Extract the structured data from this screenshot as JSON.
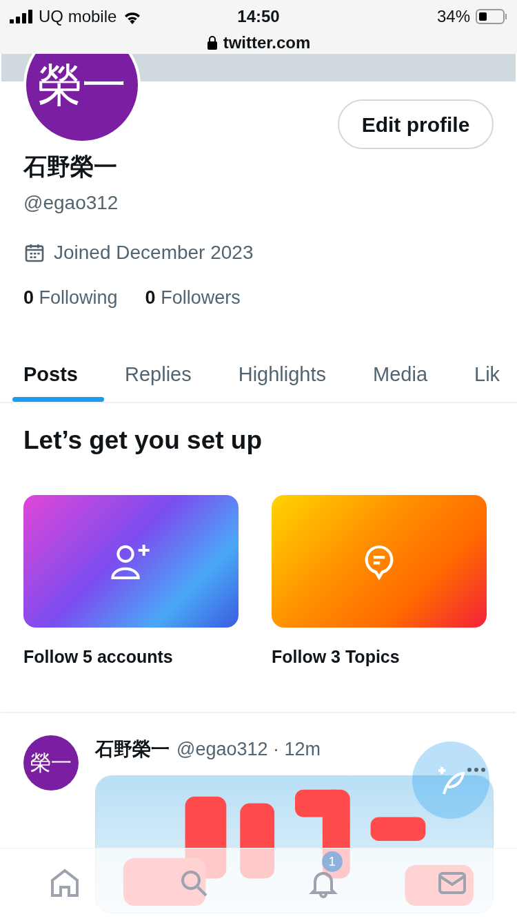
{
  "status_bar": {
    "carrier": "UQ mobile",
    "time": "14:50",
    "battery": "34%",
    "url": "twitter.com"
  },
  "profile": {
    "avatar_text": "榮一",
    "edit_button": "Edit profile",
    "name": "石野榮一",
    "handle": "@egao312",
    "joined": "Joined December 2023",
    "following_count": "0",
    "following_label": "Following",
    "followers_count": "0",
    "followers_label": "Followers"
  },
  "tabs": [
    {
      "label": "Posts",
      "selected": true
    },
    {
      "label": "Replies",
      "selected": false
    },
    {
      "label": "Highlights",
      "selected": false
    },
    {
      "label": "Media",
      "selected": false
    },
    {
      "label": "Lik",
      "selected": false
    }
  ],
  "setup": {
    "title": "Let’s get you set up",
    "cards": [
      {
        "kind": "accounts",
        "label": "Follow 5 accounts"
      },
      {
        "kind": "topics",
        "label": "Follow 3 Topics"
      }
    ]
  },
  "post": {
    "avatar_text": "榮一",
    "name": "石野榮一",
    "meta": "@egao312 · 12m"
  },
  "bottom_nav": [
    {
      "kind": "home"
    },
    {
      "kind": "search"
    },
    {
      "kind": "notifications",
      "badge": "1"
    },
    {
      "kind": "messages"
    }
  ]
}
